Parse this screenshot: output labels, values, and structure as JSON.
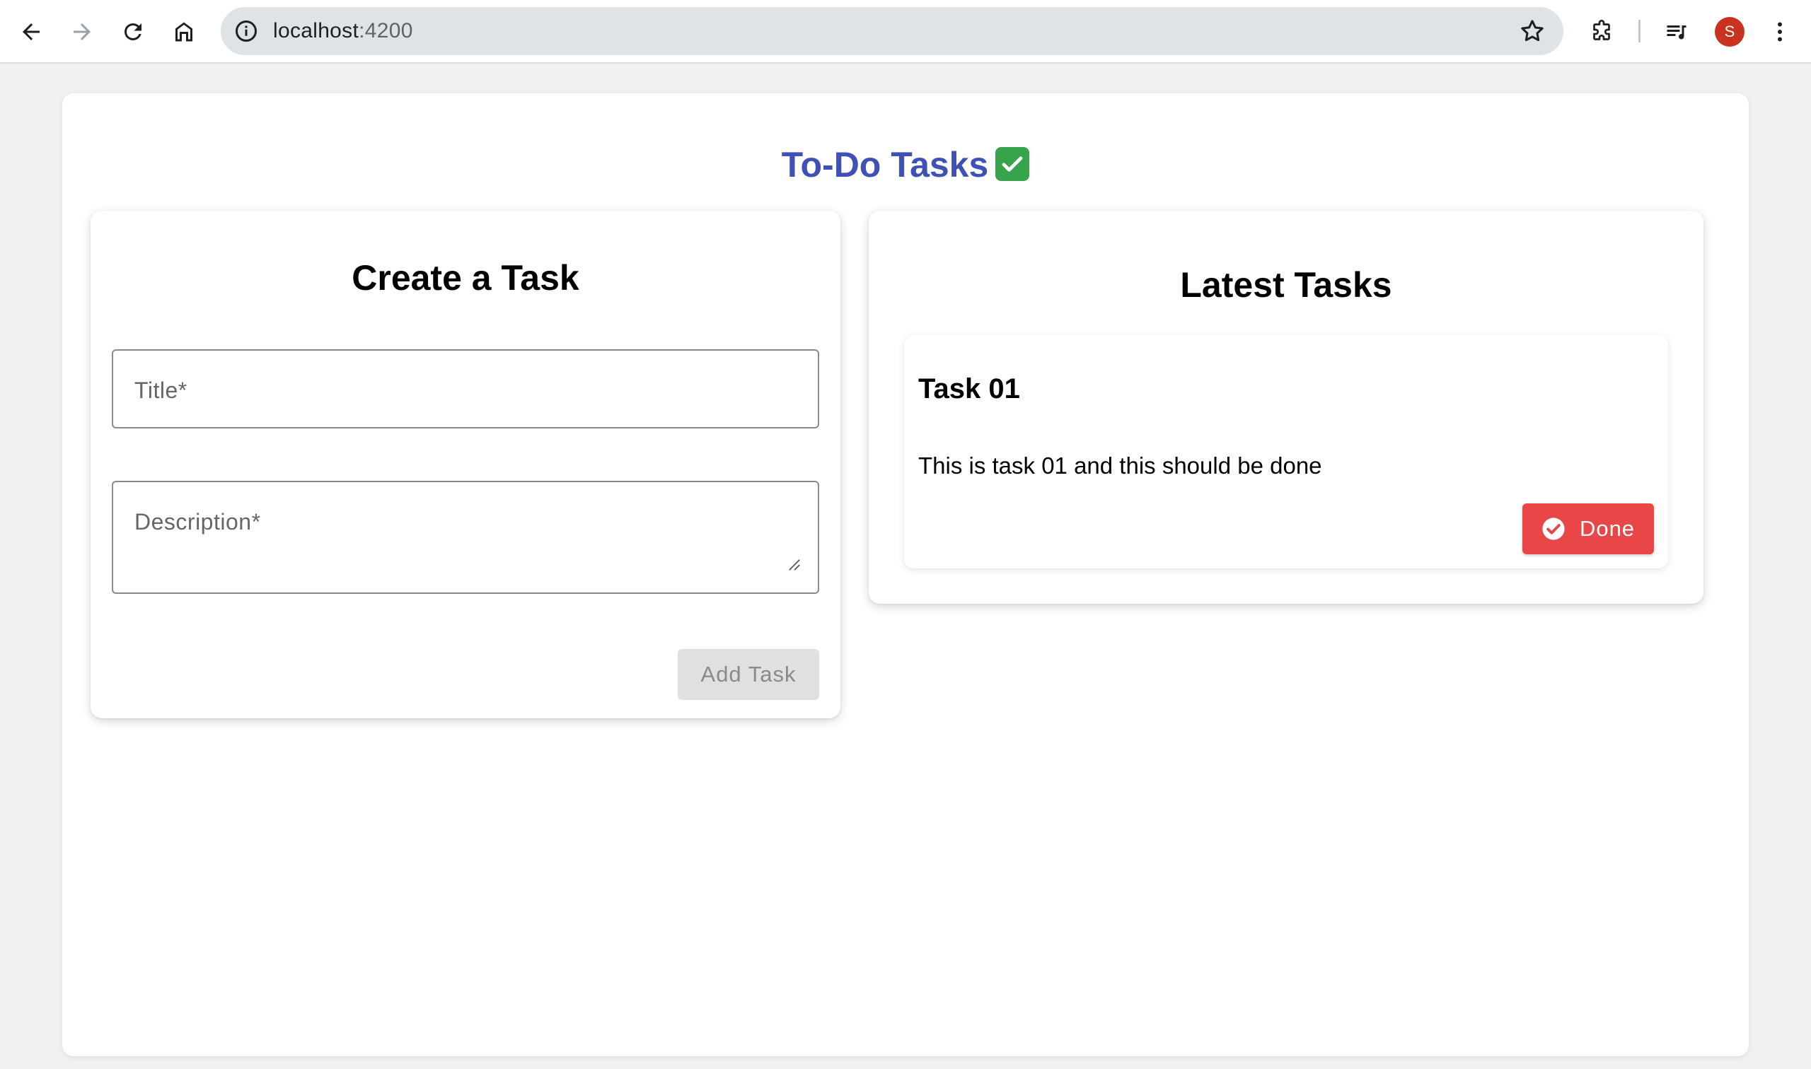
{
  "browser": {
    "url_host": "localhost",
    "url_port": ":4200",
    "profile_initial": "S",
    "profile_color": "#c8321e"
  },
  "app": {
    "title": "To-Do Tasks",
    "title_color": "#3f51b5",
    "title_emoji": "check-mark-button-icon"
  },
  "create_task": {
    "heading": "Create a Task",
    "title_placeholder": "Title*",
    "description_placeholder": "Description*",
    "submit_label": "Add Task",
    "submit_disabled": true
  },
  "latest_tasks": {
    "heading": "Latest Tasks",
    "tasks": [
      {
        "title": "Task 01",
        "description": "This is task 01 and this should be done",
        "action_label": "Done",
        "action_color": "#e94747"
      }
    ]
  }
}
